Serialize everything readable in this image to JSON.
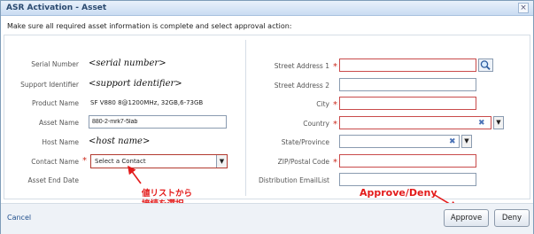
{
  "window": {
    "title": "ASR Activation - Asset",
    "close_glyph": "×"
  },
  "instruction": "Make sure all required asset information is complete and select approval action:",
  "left": {
    "serial": {
      "label": "Serial Number",
      "value": "<serial number>"
    },
    "support": {
      "label": "Support Identifier",
      "value": "<support identifier>"
    },
    "product": {
      "label": "Product Name",
      "value": "SF V880 8@1200MHz, 32GB,6-73GB"
    },
    "asset_name": {
      "label": "Asset Name",
      "value": "880-2-mrk7-5lab"
    },
    "host": {
      "label": "Host Name",
      "value": "<host name>"
    },
    "contact": {
      "label": "Contact Name",
      "value": "Select a Contact"
    },
    "end_date": {
      "label": "Asset End Date",
      "value": ""
    }
  },
  "right": {
    "street1": {
      "label": "Street Address 1",
      "value": ""
    },
    "street2": {
      "label": "Street Address 2",
      "value": ""
    },
    "city": {
      "label": "City",
      "value": ""
    },
    "country": {
      "label": "Country",
      "value": ""
    },
    "state": {
      "label": "State/Province",
      "value": ""
    },
    "zip": {
      "label": "ZIP/Postal Code",
      "value": ""
    },
    "email": {
      "label": "Distribution EmailList",
      "value": ""
    }
  },
  "glyphs": {
    "required": "*",
    "dropdown": "▼",
    "clear": "✖"
  },
  "annotations": {
    "jp_line1": "値リストから",
    "jp_line2": "接続を選択",
    "approve_deny": "Approve/Deny"
  },
  "footer": {
    "cancel": "Cancel",
    "approve": "Approve",
    "deny": "Deny"
  },
  "colors": {
    "required": "#cc2a1d",
    "annotation": "#e31b1b",
    "link": "#1f4e8c"
  }
}
